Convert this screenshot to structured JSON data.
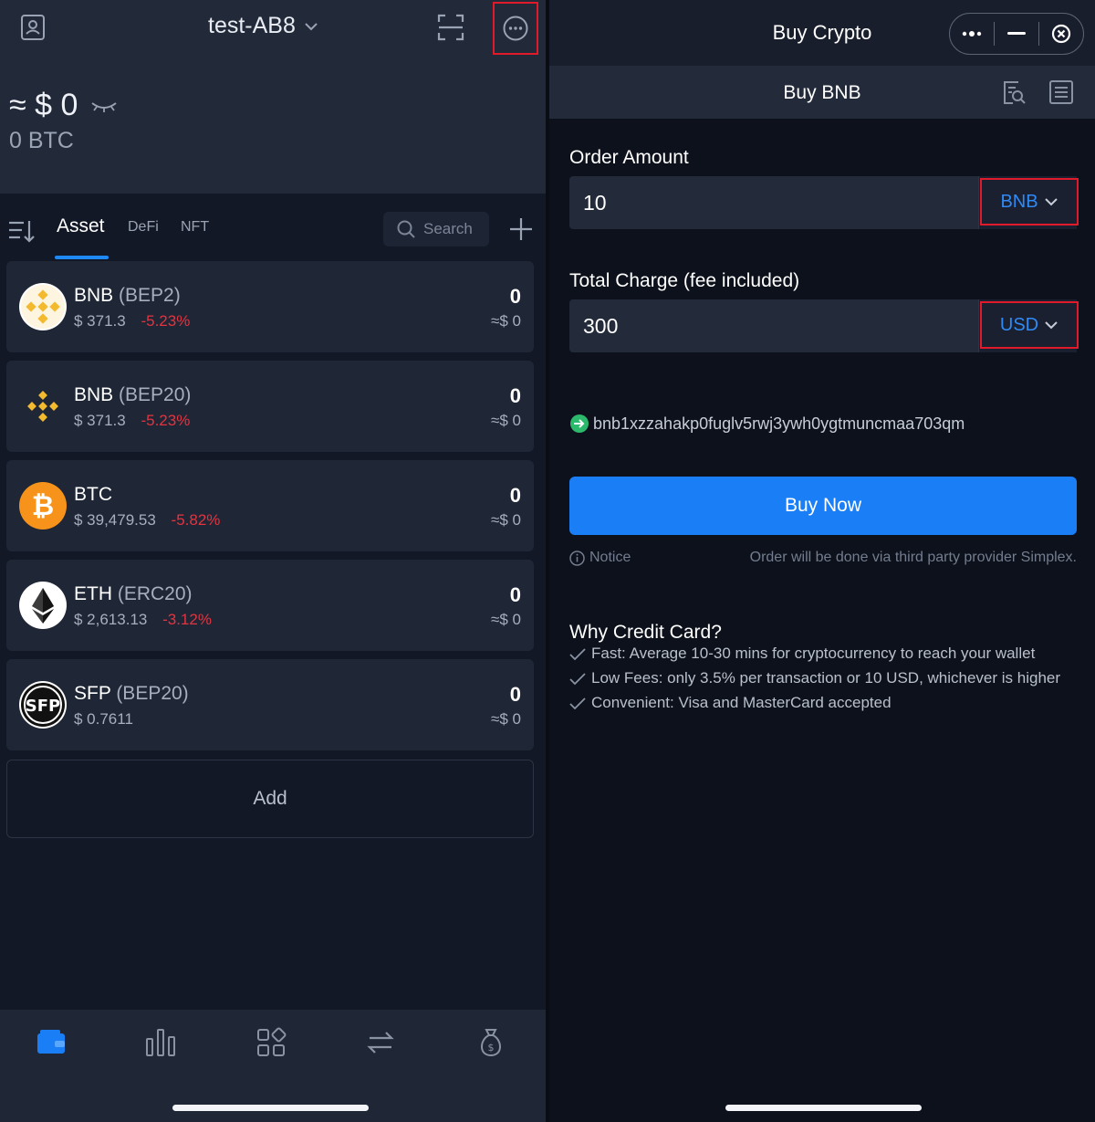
{
  "left": {
    "header": {
      "wallet_name": "test-AB8",
      "balance": "≈ $ 0",
      "btc_balance": "0 BTC"
    },
    "tabs": [
      {
        "label": "Asset",
        "active": true
      },
      {
        "label": "DeFi",
        "active": false
      },
      {
        "label": "NFT",
        "active": false
      }
    ],
    "search": {
      "placeholder": "Search"
    },
    "assets": [
      {
        "symbol": "BNB",
        "chain": "(BEP2)",
        "price": "$ 371.3",
        "change": "-5.23%",
        "qty": "0",
        "fiat": "≈$ 0",
        "icon": "bnb-icon"
      },
      {
        "symbol": "BNB",
        "chain": "(BEP20)",
        "price": "$ 371.3",
        "change": "-5.23%",
        "qty": "0",
        "fiat": "≈$ 0",
        "icon": "bnb-icon"
      },
      {
        "symbol": "BTC",
        "chain": "",
        "price": "$ 39,479.53",
        "change": "-5.82%",
        "qty": "0",
        "fiat": "≈$ 0",
        "icon": "btc-icon"
      },
      {
        "symbol": "ETH",
        "chain": "(ERC20)",
        "price": "$ 2,613.13",
        "change": "-3.12%",
        "qty": "0",
        "fiat": "≈$ 0",
        "icon": "eth-icon"
      },
      {
        "symbol": "SFP",
        "chain": "(BEP20)",
        "price": "$ 0.7611",
        "change": "",
        "qty": "0",
        "fiat": "≈$ 0",
        "icon": "sfp-icon"
      }
    ],
    "add_label": "Add",
    "bottom_nav": [
      "wallet-icon",
      "market-chart-icon",
      "apps-grid-icon",
      "swap-icon",
      "earn-moneybag-icon"
    ]
  },
  "right": {
    "title": "Buy Crypto",
    "subtitle": "Buy BNB",
    "order_amount": {
      "label": "Order Amount",
      "value": "10",
      "unit": "BNB"
    },
    "total_charge": {
      "label": "Total Charge (fee included)",
      "value": "300",
      "unit": "USD"
    },
    "address": "bnb1xzzahakp0fuglv5rwj3ywh0ygtmuncmaa703qm",
    "buy_button": "Buy Now",
    "notice": {
      "label": "Notice",
      "text": "Order will be done via third party provider Simplex."
    },
    "why": {
      "title": "Why Credit Card?",
      "items": [
        "Fast: Average 10-30 mins for cryptocurrency to reach your wallet",
        "Low Fees: only 3.5% per transaction or 10 USD, whichever is higher",
        "Convenient: Visa and MasterCard accepted"
      ]
    }
  },
  "colors": {
    "accent": "#1a7ff6",
    "negative": "#e5333f",
    "highlight_box": "#e11a2b",
    "bnb_yellow": "#f3ba2f",
    "btc_orange": "#f7931a"
  }
}
